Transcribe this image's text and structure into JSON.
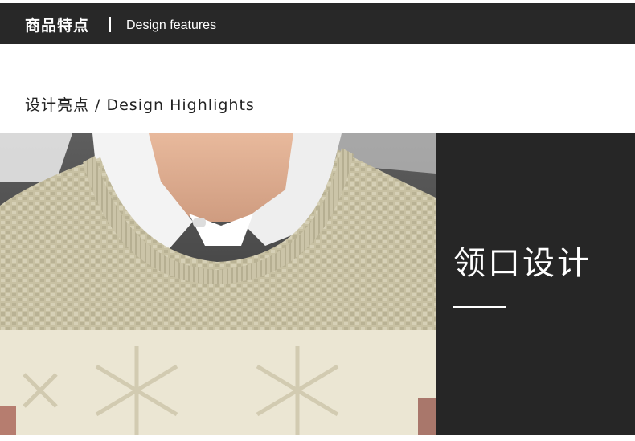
{
  "header": {
    "title_cn": "商品特点",
    "title_en": "Design features"
  },
  "section": {
    "heading": "设计亮点 / Design Highlights"
  },
  "feature": {
    "title": "领口设计"
  },
  "colors": {
    "header_bg": "#282828",
    "panel_bg": "#262626",
    "sweater_top": "#c9c2a4",
    "sweater_bottom": "#ece7d4",
    "shirt": "#f1f1f1"
  }
}
